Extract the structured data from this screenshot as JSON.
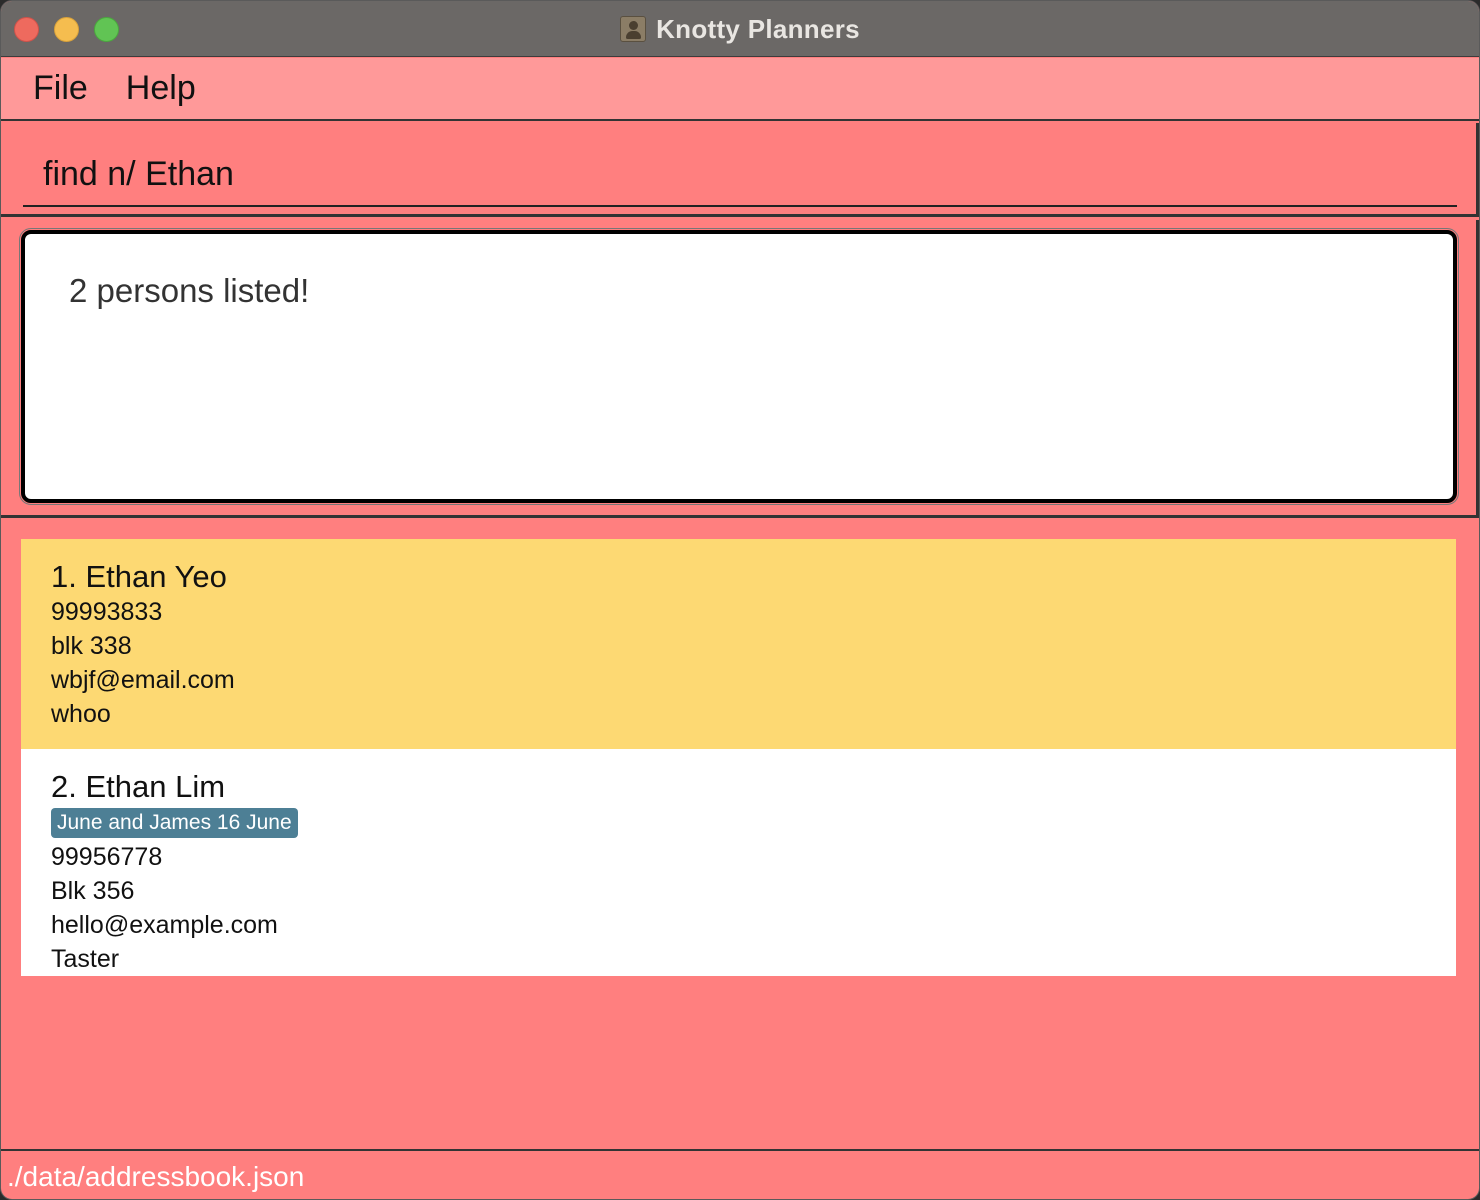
{
  "window": {
    "title": "Knotty Planners"
  },
  "menu": {
    "file": "File",
    "help": "Help"
  },
  "command": {
    "value": "find n/ Ethan"
  },
  "result": {
    "message": "2 persons listed!"
  },
  "persons": [
    {
      "name": "1. Ethan Yeo",
      "tags": [],
      "phone": "99993833",
      "address": "blk 338",
      "email": "wbjf@email.com",
      "remark": "whoo",
      "selected": true
    },
    {
      "name": "2. Ethan Lim",
      "tags": [
        "June and James 16 June"
      ],
      "phone": "99956778",
      "address": "Blk 356",
      "email": "hello@example.com",
      "remark": "Taster",
      "selected": false
    }
  ],
  "status": {
    "file_path": "./data/addressbook.json"
  },
  "colors": {
    "background": "#ff7f7f",
    "menubar": "#ff9999",
    "selected_card": "#fdd973",
    "tag": "#4d7f95"
  }
}
